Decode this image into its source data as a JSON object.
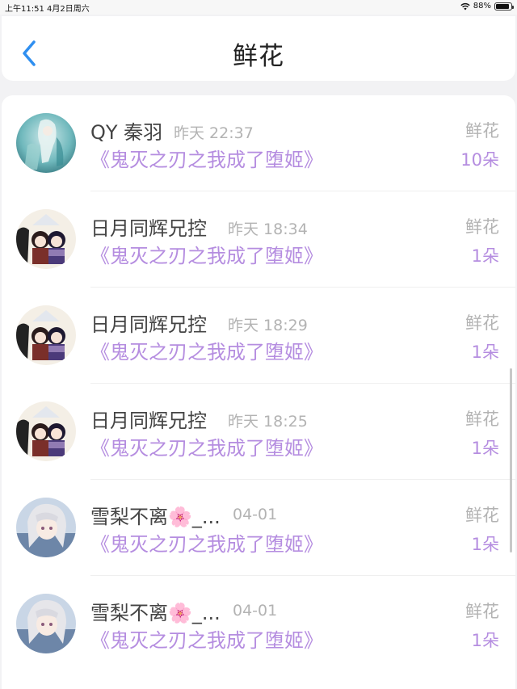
{
  "status_bar": {
    "left_text": "上午11:51   4月2日周六",
    "battery": "88%",
    "battery_level": 0.88
  },
  "header": {
    "title": "鲜花"
  },
  "rows": [
    {
      "name": "QY 秦羽",
      "time": "昨天 22:37",
      "book": "《鬼灭之刃之我成了堕姬》",
      "gift_label": "鲜花",
      "gift_count": "10朵",
      "avatar": "anime-avatar-teal"
    },
    {
      "name": "日月同辉兄控",
      "time": "昨天 18:34",
      "book": "《鬼灭之刃之我成了堕姬》",
      "gift_label": "鲜花",
      "gift_count": "1朵",
      "avatar": "chibi-pair-avatar"
    },
    {
      "name": "日月同辉兄控",
      "time": "昨天 18:29",
      "book": "《鬼灭之刃之我成了堕姬》",
      "gift_label": "鲜花",
      "gift_count": "1朵",
      "avatar": "chibi-pair-avatar"
    },
    {
      "name": "日月同辉兄控",
      "time": "昨天 18:25",
      "book": "《鬼灭之刃之我成了堕姬》",
      "gift_label": "鲜花",
      "gift_count": "1朵",
      "avatar": "chibi-pair-avatar"
    },
    {
      "name": "雪梨不离🌸_...",
      "time": "04-01",
      "book": "《鬼灭之刃之我成了堕姬》",
      "gift_label": "鲜花",
      "gift_count": "1朵",
      "avatar": "silver-hair-anime-avatar"
    },
    {
      "name": "雪梨不离🌸_...",
      "time": "04-01",
      "book": "《鬼灭之刃之我成了堕姬》",
      "gift_label": "鲜花",
      "gift_count": "1朵",
      "avatar": "silver-hair-anime-avatar"
    }
  ],
  "colors": {
    "accent_purple": "#b58de0",
    "back_blue": "#2f8ff0",
    "muted_gray": "#b3b3b3"
  }
}
